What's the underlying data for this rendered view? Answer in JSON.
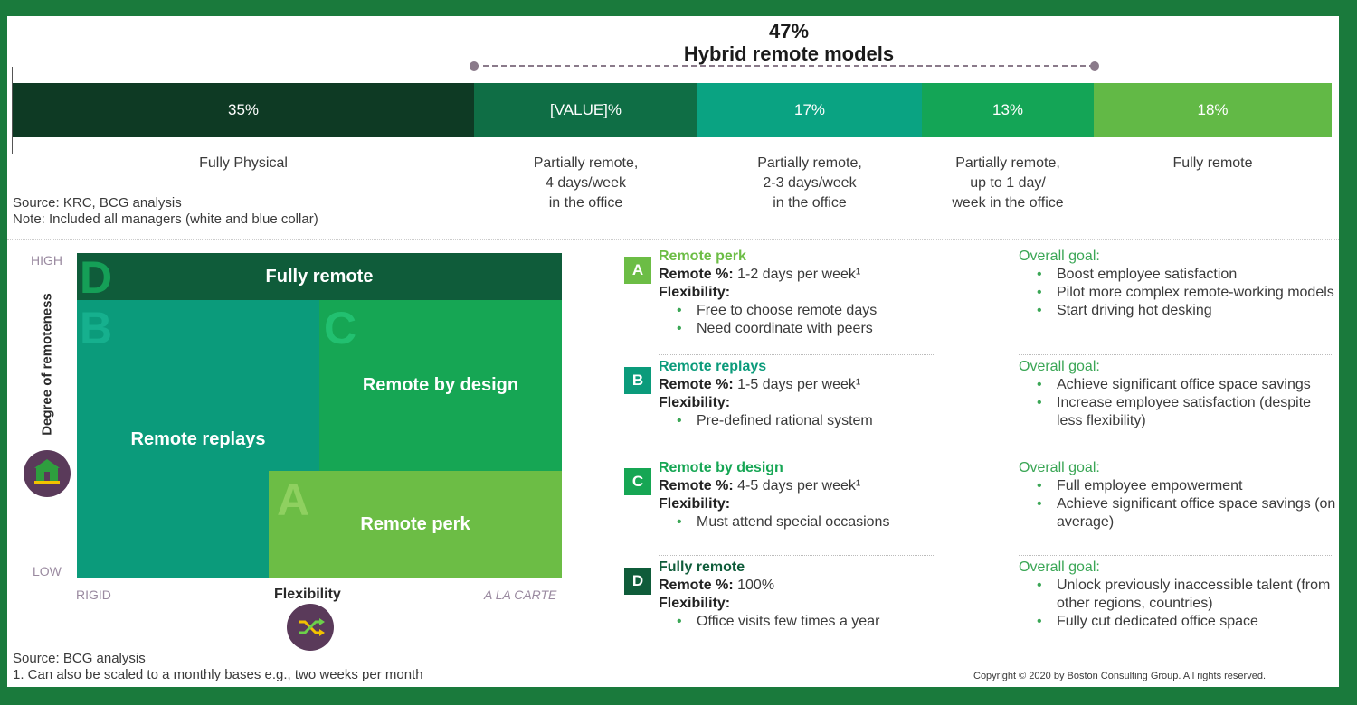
{
  "header": {
    "pct": "47%",
    "title": "Hybrid remote models"
  },
  "chart_data": {
    "type": "bar",
    "stacked": true,
    "orientation": "horizontal",
    "categories": [
      "Fully Physical",
      "Partially remote, 4 days/week in the office",
      "Partially remote, 2-3 days/week in the office",
      "Partially remote, up to 1 day/ week in the office",
      "Fully remote"
    ],
    "values": [
      35,
      17,
      17,
      13,
      18
    ],
    "value_labels": [
      "35%",
      "[VALUE]%",
      "17%",
      "13%",
      "18%"
    ],
    "colors": [
      "#0e3a24",
      "#0f6e45",
      "#0aa382",
      "#14a556",
      "#62b946"
    ],
    "labels": [
      [
        "Fully Physical"
      ],
      [
        "Partially remote,",
        "4 days/week",
        "in the office"
      ],
      [
        "Partially remote,",
        "2-3 days/week",
        "in the office"
      ],
      [
        "Partially remote,",
        "up to 1 day/",
        "week in the office"
      ],
      [
        "Fully remote"
      ]
    ]
  },
  "notes_top": {
    "source": "Source: KRC, BCG analysis",
    "note": "Note: Included all managers (white and blue collar)"
  },
  "matrix": {
    "y_high": "HIGH",
    "y_low": "LOW",
    "y_axis": "Degree of remoteness",
    "x_left": "RIGID",
    "x_axis": "Flexibility",
    "x_right": "A LA CARTE",
    "boxes": {
      "D": {
        "letter": "D",
        "label": "Fully remote",
        "color": "#0f5c3a"
      },
      "B": {
        "letter": "B",
        "label": "Remote replays",
        "color": "#0b9b7b"
      },
      "C": {
        "letter": "C",
        "label": "Remote by design",
        "color": "#16a654"
      },
      "A": {
        "letter": "A",
        "label": "Remote perk",
        "color": "#6cbd45"
      }
    },
    "home_icon": "home-icon",
    "shuffle_icon": "shuffle-icon"
  },
  "segments": [
    {
      "letter": "A",
      "color": "#6cbd45",
      "title": "Remote perk",
      "remote_label": "Remote %:",
      "remote_value": " 1-2 days per week¹",
      "flex_label": "Flexibility:",
      "flex": [
        "Free to choose remote days",
        "Need coordinate with peers"
      ],
      "goal_title": "Overall goal:",
      "goals": [
        "Boost employee satisfaction",
        "Pilot more complex remote-working models",
        "Start driving hot desking"
      ]
    },
    {
      "letter": "B",
      "color": "#0b9b7b",
      "title": "Remote replays",
      "remote_label": "Remote %:",
      "remote_value": " 1-5 days per week¹",
      "flex_label": "Flexibility:",
      "flex": [
        "Pre-defined rational system"
      ],
      "goal_title": "Overall goal:",
      "goals": [
        "Achieve significant office space savings",
        "Increase employee satisfaction (despite less flexibility)"
      ]
    },
    {
      "letter": "C",
      "color": "#16a654",
      "title": "Remote by design",
      "remote_label": "Remote %:",
      "remote_value": " 4-5 days per week¹",
      "flex_label": "Flexibility:",
      "flex": [
        "Must attend special occasions"
      ],
      "goal_title": "Overall goal:",
      "goals": [
        "Full employee empowerment",
        "Achieve significant office space savings (on average)"
      ]
    },
    {
      "letter": "D",
      "color": "#0f5c3a",
      "title": "Fully remote",
      "remote_label": "Remote %:",
      "remote_value": " 100%",
      "flex_label": "Flexibility:",
      "flex": [
        "Office visits few times a year"
      ],
      "goal_title": "Overall goal:",
      "goals": [
        "Unlock previously inaccessible talent (from other regions, countries)",
        "Fully cut dedicated office space"
      ]
    }
  ],
  "footer": {
    "source": "Source: BCG analysis",
    "footnote": "1. Can also be scaled to a monthly bases e.g., two weeks per month",
    "copyright": "Copyright © 2020 by Boston Consulting Group. All rights reserved."
  }
}
